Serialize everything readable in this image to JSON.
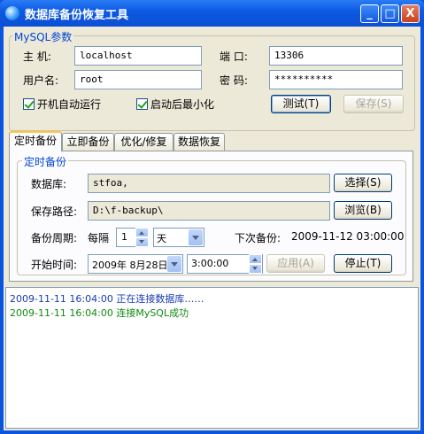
{
  "window": {
    "title": "数据库备份恢复工具",
    "controls": {
      "minimize": "_",
      "maximize": "□",
      "close": "X"
    }
  },
  "mysql": {
    "group_label": "MySQL参数",
    "host_label": "主  机:",
    "host_value": "localhost",
    "port_label": "端  口:",
    "port_value": "13306",
    "user_label": "用户名:",
    "user_value": "root",
    "password_label": "密  码:",
    "password_value": "**********",
    "autostart_label": "开机自动运行",
    "autostart_checked": true,
    "minimize_label": "启动后最小化",
    "minimize_checked": true,
    "test_button": "测试(T)",
    "save_button": "保存(S)"
  },
  "tabs": [
    {
      "label": "定时备份",
      "active": true
    },
    {
      "label": "立即备份",
      "active": false
    },
    {
      "label": "优化/修复",
      "active": false
    },
    {
      "label": "数据恢复",
      "active": false
    }
  ],
  "schedule": {
    "group_label": "定时备份",
    "database_label": "数据库:",
    "database_value": "stfoa,",
    "choose_button": "选择(S)",
    "path_label": "保存路径:",
    "path_value": "D:\\f-backup\\",
    "browse_button": "浏览(B)",
    "period_label": "备份周期:",
    "every_label": "每隔",
    "period_value": "1",
    "period_unit": "天",
    "next_backup_label": "下次备份:",
    "next_backup_value": "2009-11-12 03:00:00",
    "start_label": "开始时间:",
    "start_date": "2009年 8月28日",
    "start_time": "3:00:00",
    "apply_button": "应用(A)",
    "stop_button": "停止(T)"
  },
  "log": [
    {
      "time": "2009-11-11 16:04:00",
      "message": "正在连接数据库……",
      "color": "#1a3bb0"
    },
    {
      "time": "2009-11-11 16:04:00",
      "message": "连接MySQL成功",
      "color": "#118a11"
    }
  ]
}
